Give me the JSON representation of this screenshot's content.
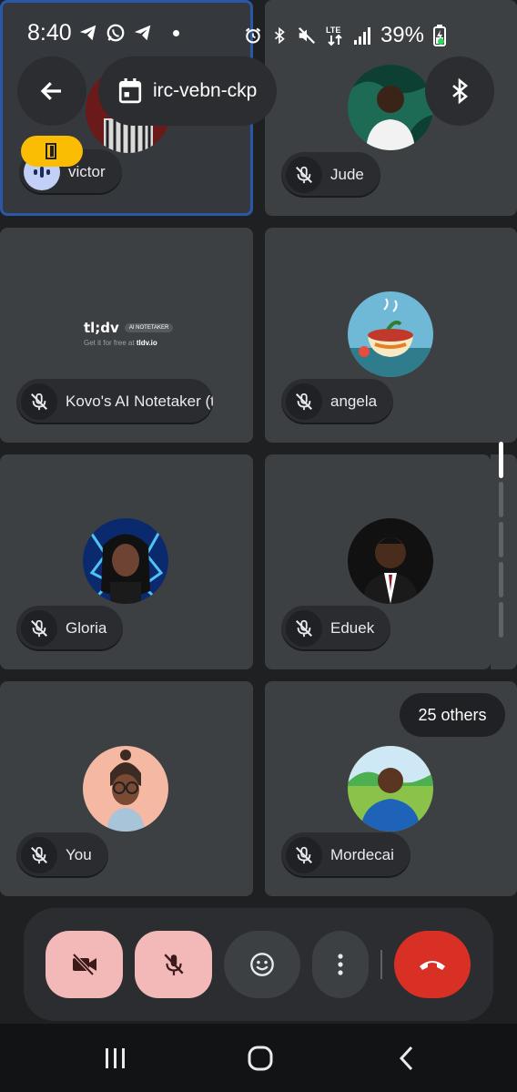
{
  "status_bar": {
    "time": "8:40",
    "battery": "39%",
    "left_icons": [
      "telegram-icon",
      "whatsapp-icon",
      "telegram-icon",
      "dot"
    ],
    "right_icons": [
      "alarm-icon",
      "bluetooth-icon",
      "mute-icon",
      "lte-icon",
      "signal-icon",
      "battery-charging-icon"
    ]
  },
  "header": {
    "meeting_code": "irc-vebn-ckp",
    "back_icon": "arrow-back-icon",
    "calendar_icon": "calendar-icon",
    "audio_output_icon": "bluetooth-icon"
  },
  "participants": [
    {
      "name": "victor",
      "mic": "speaking",
      "avatar": "photo",
      "active": true,
      "badge": "exit-door-icon"
    },
    {
      "name": "Jude",
      "mic": "muted",
      "avatar": "photo"
    },
    {
      "name": "Kovo's AI Notetaker (tl",
      "mic": "muted",
      "avatar": "tldv-logo"
    },
    {
      "name": "angela",
      "mic": "muted",
      "avatar": "illustration"
    },
    {
      "name": "Gloria",
      "mic": "muted",
      "avatar": "illustration"
    },
    {
      "name": "Eduek",
      "mic": "muted",
      "avatar": "photo"
    },
    {
      "name": "You",
      "mic": "muted",
      "avatar": "illustration"
    },
    {
      "name": "Mordecai",
      "mic": "muted",
      "avatar": "photo"
    }
  ],
  "notetaker": {
    "brand": "tl;dv",
    "tag": "AI NOTETAKER",
    "tagline_prefix": "Get it for free at",
    "tagline_link": "tldv.io"
  },
  "others_label": "25 others",
  "controls": [
    {
      "id": "camera",
      "icon": "camera-off-icon",
      "state": "off"
    },
    {
      "id": "mic",
      "icon": "mic-off-icon",
      "state": "off"
    },
    {
      "id": "reactions",
      "icon": "emoji-icon"
    },
    {
      "id": "more",
      "icon": "more-vert-icon"
    },
    {
      "id": "end",
      "icon": "call-end-icon"
    }
  ],
  "nav": [
    "recent-apps-icon",
    "home-icon",
    "back-icon"
  ],
  "colors": {
    "tile": "#3c4043",
    "active_border": "#2b57a8",
    "control_off": "#f3b8b8",
    "end_call": "#d93025",
    "exit_badge": "#fbbc04"
  }
}
